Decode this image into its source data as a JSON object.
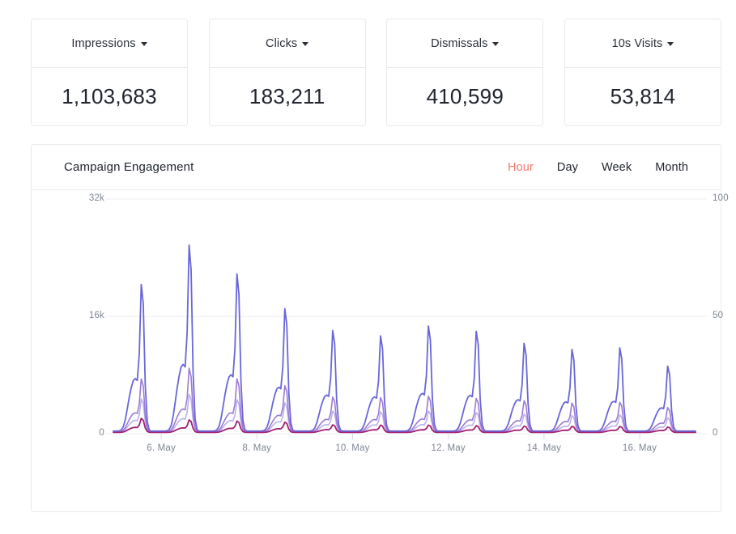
{
  "kpis": [
    {
      "label": "Impressions",
      "value": "1,103,683",
      "icon": "chevron-down-icon"
    },
    {
      "label": "Clicks",
      "value": "183,211",
      "icon": "chevron-down-icon"
    },
    {
      "label": "Dismissals",
      "value": "410,599",
      "icon": "chevron-down-icon"
    },
    {
      "label": "10s Visits",
      "value": "53,814",
      "icon": "chevron-down-icon"
    }
  ],
  "chart_card": {
    "title": "Campaign Engagement",
    "tabs": [
      {
        "label": "Hour",
        "active": true
      },
      {
        "label": "Day",
        "active": false
      },
      {
        "label": "Week",
        "active": false
      },
      {
        "label": "Month",
        "active": false
      }
    ]
  },
  "colors": {
    "accent": "#f4796b",
    "series_1": "#6a66d8",
    "series_2": "#9b7ad4",
    "series_3": "#bcb0ec",
    "series_4": "#a41f73",
    "gridline": "#eceef1",
    "card_border": "#e8eaed",
    "text": "#21252e",
    "axis_text": "#7f8694"
  },
  "chart_data": {
    "type": "line",
    "title": "Campaign Engagement",
    "xlabel": "",
    "ylabel": "",
    "grid": true,
    "legend_position": "none",
    "x_tick_labels": [
      "6. May",
      "8. May",
      "10. May",
      "12. May",
      "14. May",
      "16. May"
    ],
    "x_tick_days": [
      1,
      3,
      5,
      7,
      9,
      11
    ],
    "y_left": {
      "label": "",
      "ticks": [
        "0",
        "16k",
        "32k"
      ],
      "tick_values": [
        0,
        16000,
        32000
      ],
      "ylim": [
        0,
        32000
      ]
    },
    "y_right": {
      "label": "",
      "ticks": [
        "0",
        "50",
        "100"
      ],
      "tick_values": [
        0,
        50,
        100
      ],
      "ylim": [
        0,
        100
      ]
    },
    "x_range_days": [
      0,
      12.2
    ],
    "note": "Hourly resolution; one sharp daily peak per day, amplitudes decaying across the range. Values expressed on the left 0-32k axis.",
    "series": [
      {
        "name": "Impressions",
        "color": "#6a66d8",
        "width": 1.8,
        "peak_values": [
          19400,
          24600,
          20800,
          16200,
          13300,
          12600,
          13900,
          13200,
          11600,
          10800,
          11000,
          8600
        ],
        "baseline": 350
      },
      {
        "name": "Dismissals",
        "color": "#9b7ad4",
        "width": 1.6,
        "peak_values": [
          7000,
          8400,
          7000,
          6100,
          4600,
          4500,
          4700,
          4400,
          4100,
          3800,
          3900,
          3200
        ],
        "baseline": 260
      },
      {
        "name": "Clicks",
        "color": "#bcb0ec",
        "width": 1.6,
        "peak_values": [
          4400,
          5000,
          4300,
          3900,
          2800,
          2700,
          2800,
          2600,
          2400,
          2200,
          2300,
          1900
        ],
        "baseline": 200
      },
      {
        "name": "10s Visits",
        "color": "#a41f73",
        "width": 1.8,
        "peak_values": [
          1850,
          1650,
          1500,
          1350,
          1000,
          950,
          950,
          880,
          820,
          800,
          780,
          700
        ],
        "baseline": 180
      }
    ]
  }
}
